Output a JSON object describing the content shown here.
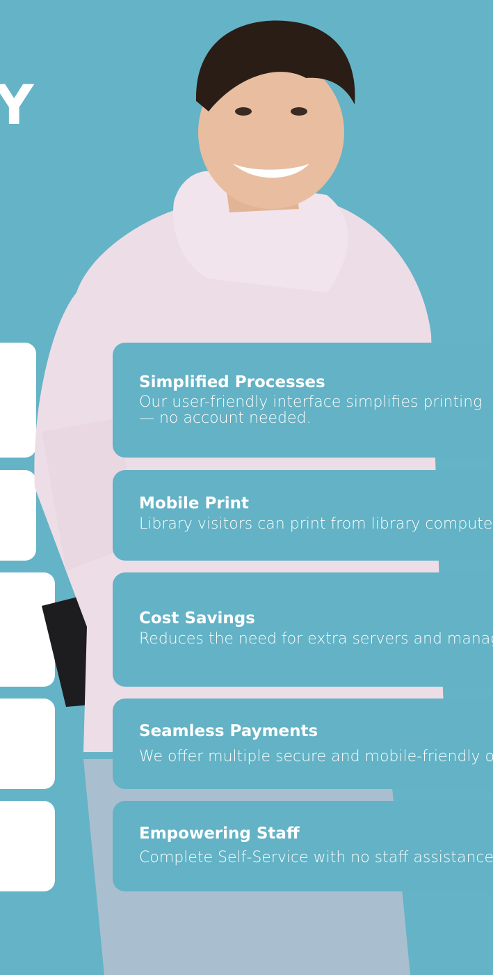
{
  "header": {
    "heading_fragment": "Y"
  },
  "colors": {
    "background": "#65b3c6",
    "card_teal": "#63b2c5",
    "card_white": "#ffffff",
    "text": "#ffffff"
  },
  "features": [
    {
      "title": "Simplified Processes",
      "description": "Our user-friendly interface simplifies printing — no account needed."
    },
    {
      "title": "Mobile Print",
      "description": "Library visitors can print from library computers"
    },
    {
      "title": "Cost Savings",
      "description": "Reduces the need for extra servers and management"
    },
    {
      "title": "Seamless Payments",
      "description": "We offer multiple secure and mobile-friendly options"
    },
    {
      "title": "Empowering Staff",
      "description": "Complete Self-Service with no staff assistance"
    }
  ],
  "illustration": {
    "icon": "person-with-backpack-illustration"
  }
}
